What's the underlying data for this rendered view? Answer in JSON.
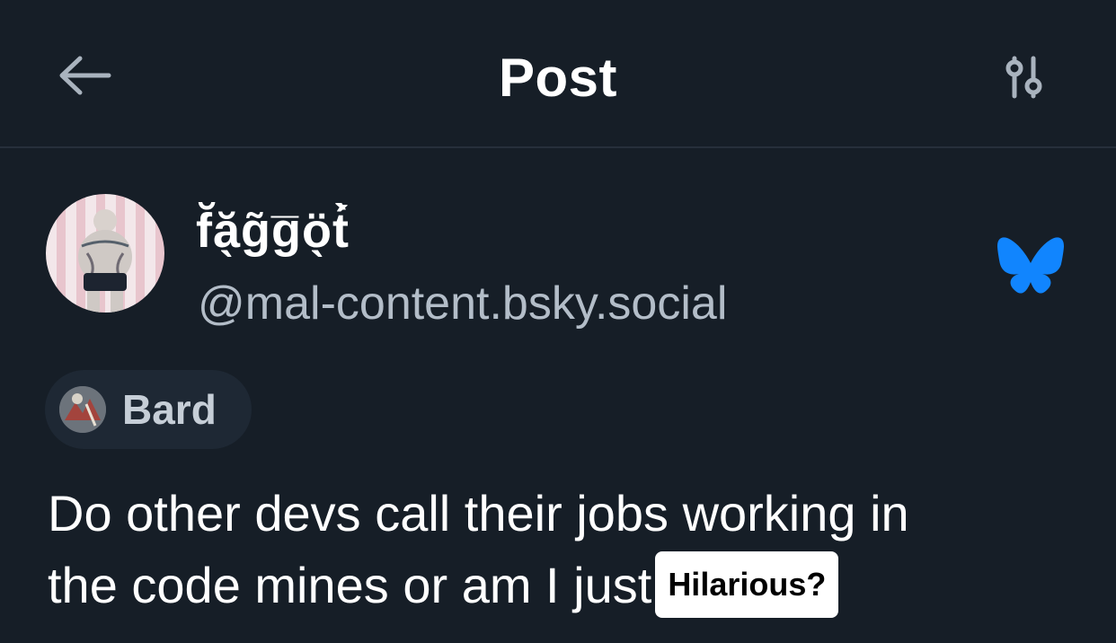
{
  "header": {
    "title": "Post",
    "back_icon": "arrow-left-icon",
    "settings_icon": "sliders-icon"
  },
  "author": {
    "display_name": "f̆ă̖g̃g̅ö̖t́̀",
    "handle": "@mal-content.bsky.social",
    "avatar_icon": "avatar-image"
  },
  "platform": {
    "logo_icon": "bluesky-butterfly-icon",
    "logo_color": "#1185fe"
  },
  "feed": {
    "label": "Bard"
  },
  "post": {
    "line1": "Do other devs call their jobs working in",
    "line2": "the code mines or am I just",
    "sticker": "Hilarious?"
  },
  "colors": {
    "background": "#161e27",
    "divider": "#262f3b",
    "muted_text": "#b3bdc8",
    "pill_background": "#1e2834"
  }
}
